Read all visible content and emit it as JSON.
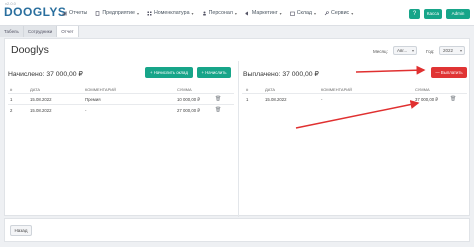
{
  "header": {
    "version": "v2.0.0",
    "logo": "DOOGLYS",
    "nav": [
      {
        "label": "Отчеты",
        "icon": "chart-icon",
        "caret": false
      },
      {
        "label": "Предприятие",
        "icon": "building-icon",
        "caret": true
      },
      {
        "label": "Номенклатура",
        "icon": "grid-icon",
        "caret": true
      },
      {
        "label": "Персонал",
        "icon": "person-icon",
        "caret": true
      },
      {
        "label": "Маркетинг",
        "icon": "megaphone-icon",
        "caret": true
      },
      {
        "label": "Склад",
        "icon": "box-icon",
        "caret": true
      },
      {
        "label": "Сервис",
        "icon": "wrench-icon",
        "caret": true
      }
    ],
    "help_label": "?",
    "cash_label": "Касса",
    "user_label": "Admin"
  },
  "tabs": [
    "Табель",
    "Сотрудники",
    "Отчет"
  ],
  "page": {
    "title": "Dooglys",
    "month_label": "Месяц:",
    "month_value": "Авг...",
    "year_label": "Год:",
    "year_value": "2022"
  },
  "left": {
    "title": "Начислено: 37 000,00 ₽",
    "btn_salary": "+ Начислить оклад",
    "btn_accrue": "+ Начислить",
    "columns": [
      "#",
      "ДАТА",
      "КОММЕНТАРИЙ",
      "СУММА"
    ],
    "rows": [
      [
        "1",
        "15.08.2022",
        "Премия",
        "10 000,00 ₽"
      ],
      [
        "2",
        "15.08.2022",
        "-",
        "27 000,00 ₽"
      ]
    ]
  },
  "right": {
    "title": "Выплачено: 37 000,00 ₽",
    "btn_pay": "— Выплатить",
    "columns": [
      "#",
      "ДАТА",
      "КОММЕНТАРИЙ",
      "СУММА"
    ],
    "rows": [
      [
        "1",
        "15.08.2022",
        "-",
        "37 000,00 ₽"
      ]
    ]
  },
  "footer": {
    "back_label": "Назад"
  },
  "colors": {
    "accent": "#17a589",
    "danger": "#e03434",
    "arrow": "#e03030",
    "logo": "#2a6f9e"
  }
}
